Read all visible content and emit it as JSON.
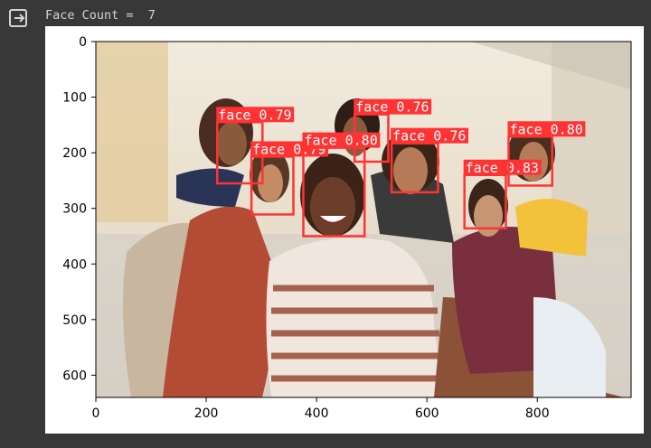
{
  "output": {
    "icon": "output-redirect-icon",
    "text": "Face Count =  7"
  },
  "chart_data": {
    "type": "image-with-detections",
    "image_width": 970,
    "image_height": 640,
    "xlim": [
      0,
      970
    ],
    "ylim": [
      640,
      0
    ],
    "xticks": [
      0,
      200,
      400,
      600,
      800
    ],
    "yticks": [
      0,
      100,
      200,
      300,
      400,
      500,
      600
    ],
    "box_color": "#ff3333",
    "detections": [
      {
        "label": "face 0.79",
        "x1": 220,
        "y1": 145,
        "x2": 302,
        "y2": 255
      },
      {
        "label": "face 0.79",
        "x1": 282,
        "y1": 207,
        "x2": 358,
        "y2": 311
      },
      {
        "label": "face 0.80",
        "x1": 376,
        "y1": 191,
        "x2": 487,
        "y2": 350
      },
      {
        "label": "face 0.76",
        "x1": 469,
        "y1": 131,
        "x2": 530,
        "y2": 216
      },
      {
        "label": "face 0.76",
        "x1": 536,
        "y1": 183,
        "x2": 620,
        "y2": 271
      },
      {
        "label": "face 0.83",
        "x1": 668,
        "y1": 240,
        "x2": 743,
        "y2": 336
      },
      {
        "label": "face 0.80",
        "x1": 748,
        "y1": 171,
        "x2": 827,
        "y2": 259
      }
    ]
  }
}
